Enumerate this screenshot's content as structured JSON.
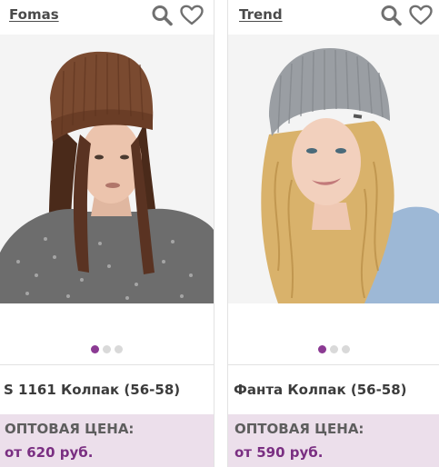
{
  "products": [
    {
      "brand": "Fomas",
      "title": "S 1161 Колпак (56-58)",
      "price_label": "ОПТОВАЯ ЦЕНА:",
      "price": "от 620 руб.",
      "hat_color": "#7a4a30",
      "icons": [
        "search-icon",
        "heart-icon"
      ],
      "carousel_active": 1,
      "carousel_count": 3
    },
    {
      "brand": "Trend",
      "title": "Фанта Колпак (56-58)",
      "price_label": "ОПТОВАЯ ЦЕНА:",
      "price": "от 590 руб.",
      "hat_color": "#9a9ea3",
      "icons": [
        "search-icon",
        "heart-icon"
      ],
      "carousel_active": 1,
      "carousel_count": 3
    }
  ],
  "colors": {
    "accent": "#8b3a93",
    "price_bg": "#ecdfeb",
    "price_text": "#7a2f82"
  }
}
